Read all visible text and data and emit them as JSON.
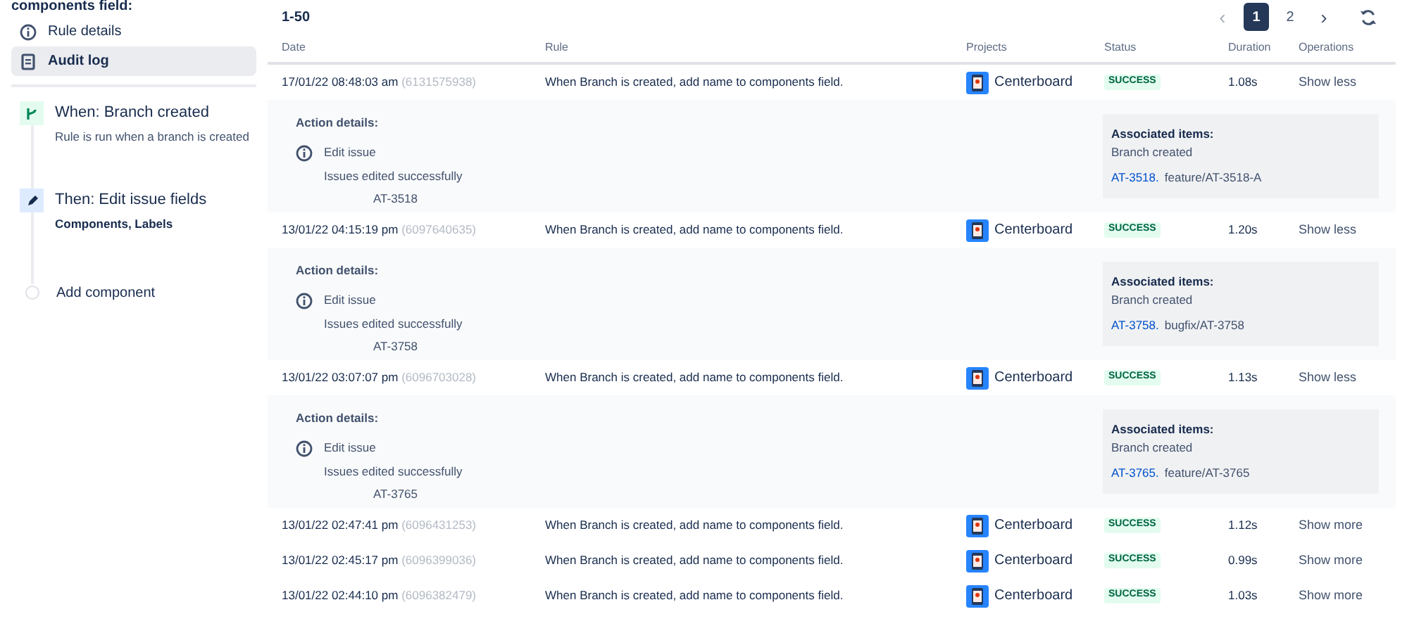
{
  "sidebar": {
    "heading": "components field:",
    "nav": [
      {
        "label": "Rule details",
        "selected": false
      },
      {
        "label": "Audit log",
        "selected": true
      }
    ],
    "steps": [
      {
        "kind": "trigger",
        "title": "When: Branch created",
        "subtitle": "Rule is run when a branch is created"
      },
      {
        "kind": "action",
        "title": "Then: Edit issue fields",
        "subtitle": "Components, Labels"
      },
      {
        "kind": "add",
        "title": "Add component"
      }
    ]
  },
  "range": "1-50",
  "pagination": {
    "prev": "‹",
    "next": "›",
    "pages": [
      {
        "label": "1",
        "selected": true
      },
      {
        "label": "2",
        "selected": false
      }
    ]
  },
  "table": {
    "columns": [
      "Date",
      "Rule",
      "Projects",
      "Status",
      "Duration",
      "Operations"
    ],
    "rows": [
      {
        "date": "17/01/22 08:48:03 am",
        "id": "(6131575938)",
        "rule": "When Branch is created, add name to components field.",
        "project": "Centerboard",
        "status": "SUCCESS",
        "duration": "1.08s",
        "operation": "Show less",
        "details": {
          "heading": "Action details:",
          "action": "Edit issue",
          "message": "Issues edited successfully",
          "issue": "AT-3518",
          "assoc_heading": "Associated items:",
          "assoc_label": "Branch created",
          "link": "AT-3518.",
          "branch": "feature/AT-3518-A"
        }
      },
      {
        "date": "13/01/22 04:15:19 pm",
        "id": "(6097640635)",
        "rule": "When Branch is created, add name to components field.",
        "project": "Centerboard",
        "status": "SUCCESS",
        "duration": "1.20s",
        "operation": "Show less",
        "details": {
          "heading": "Action details:",
          "action": "Edit issue",
          "message": "Issues edited successfully",
          "issue": "AT-3758",
          "assoc_heading": "Associated items:",
          "assoc_label": "Branch created",
          "link": "AT-3758.",
          "branch": "bugfix/AT-3758"
        }
      },
      {
        "date": "13/01/22 03:07:07 pm",
        "id": "(6096703028)",
        "rule": "When Branch is created, add name to components field.",
        "project": "Centerboard",
        "status": "SUCCESS",
        "duration": "1.13s",
        "operation": "Show less",
        "details": {
          "heading": "Action details:",
          "action": "Edit issue",
          "message": "Issues edited successfully",
          "issue": "AT-3765",
          "assoc_heading": "Associated items:",
          "assoc_label": "Branch created",
          "link": "AT-3765.",
          "branch": "feature/AT-3765"
        }
      },
      {
        "date": "13/01/22 02:47:41 pm",
        "id": "(6096431253)",
        "rule": "When Branch is created, add name to components field.",
        "project": "Centerboard",
        "status": "SUCCESS",
        "duration": "1.12s",
        "operation": "Show more"
      },
      {
        "date": "13/01/22 02:45:17 pm",
        "id": "(6096399036)",
        "rule": "When Branch is created, add name to components field.",
        "project": "Centerboard",
        "status": "SUCCESS",
        "duration": "0.99s",
        "operation": "Show more"
      },
      {
        "date": "13/01/22 02:44:10 pm",
        "id": "(6096382479)",
        "rule": "When Branch is created, add name to components field.",
        "project": "Centerboard",
        "status": "SUCCESS",
        "duration": "1.03s",
        "operation": "Show more"
      }
    ]
  }
}
